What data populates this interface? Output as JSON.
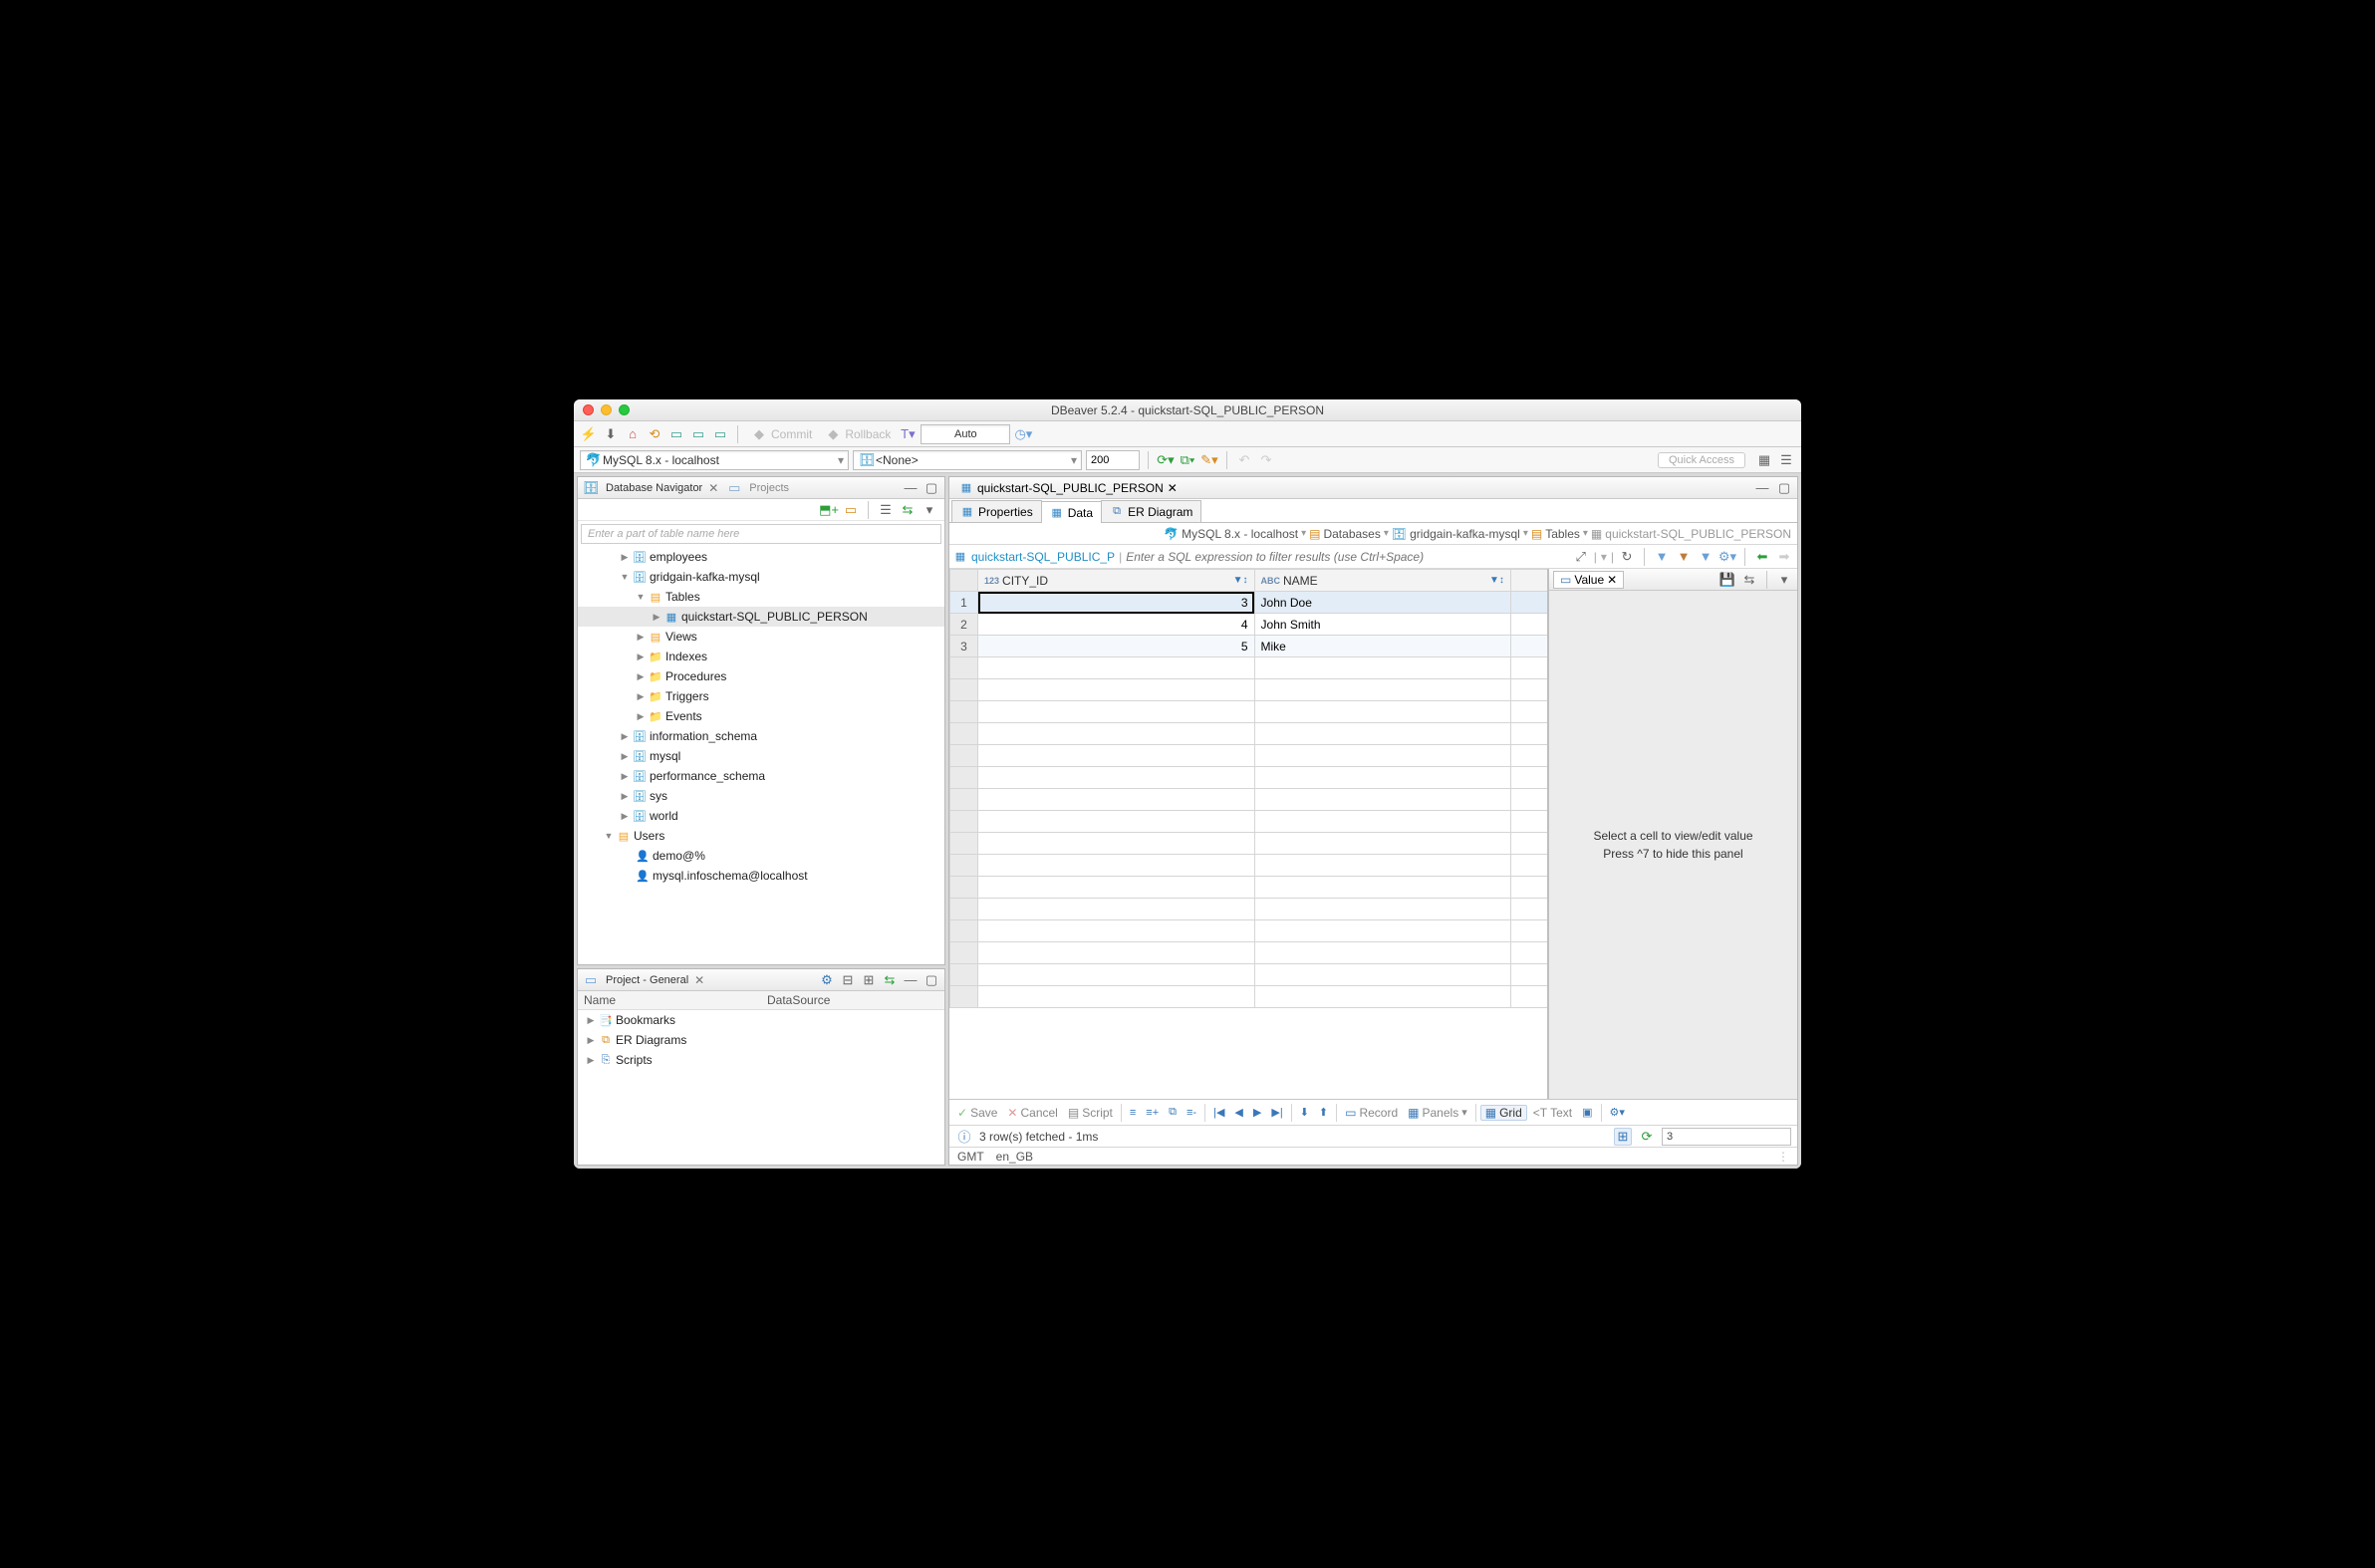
{
  "window": {
    "title": "DBeaver 5.2.4 - quickstart-SQL_PUBLIC_PERSON"
  },
  "toolbar1": {
    "commit": "Commit",
    "rollback": "Rollback",
    "mode": "Auto"
  },
  "toolbar2": {
    "connection": "MySQL 8.x - localhost",
    "database": "<None>",
    "rows": "200",
    "quick_access": "Quick Access"
  },
  "navigator": {
    "title": "Database Navigator",
    "projects_tab": "Projects",
    "search_placeholder": "Enter a part of table name here",
    "tree": {
      "employees": "employees",
      "gridgain": "gridgain-kafka-mysql",
      "tables": "Tables",
      "selected_table": "quickstart-SQL_PUBLIC_PERSON",
      "views": "Views",
      "indexes": "Indexes",
      "procedures": "Procedures",
      "triggers": "Triggers",
      "events": "Events",
      "info_schema": "information_schema",
      "mysql": "mysql",
      "perf_schema": "performance_schema",
      "sys": "sys",
      "world": "world",
      "users": "Users",
      "user1": "demo@%",
      "user2": "mysql.infoschema@localhost"
    }
  },
  "project_panel": {
    "title": "Project - General",
    "col_name": "Name",
    "col_ds": "DataSource",
    "items": {
      "bookmarks": "Bookmarks",
      "er": "ER Diagrams",
      "scripts": "Scripts"
    }
  },
  "editor": {
    "tab_title": "quickstart-SQL_PUBLIC_PERSON",
    "subtabs": {
      "properties": "Properties",
      "data": "Data",
      "er": "ER Diagram"
    },
    "breadcrumb": {
      "conn": "MySQL 8.x - localhost",
      "dbs": "Databases",
      "db": "gridgain-kafka-mysql",
      "tables": "Tables",
      "table": "quickstart-SQL_PUBLIC_PERSON"
    },
    "filter": {
      "title": "quickstart-SQL_PUBLIC_P",
      "placeholder": "Enter a SQL expression to filter results (use Ctrl+Space)"
    },
    "columns": {
      "c1": "CITY_ID",
      "c2": "NAME",
      "t1": "123",
      "t2": "ABC"
    },
    "rows": [
      {
        "n": "1",
        "city_id": "3",
        "name": "John Doe"
      },
      {
        "n": "2",
        "city_id": "4",
        "name": "John Smith"
      },
      {
        "n": "3",
        "city_id": "5",
        "name": "Mike"
      }
    ],
    "value_panel": {
      "title": "Value",
      "msg1": "Select a cell to view/edit value",
      "msg2": "Press ^7 to hide this panel"
    },
    "bottombar": {
      "save": "Save",
      "cancel": "Cancel",
      "script": "Script",
      "record": "Record",
      "panels": "Panels",
      "grid": "Grid",
      "text": "Text"
    },
    "status": {
      "msg": "3 row(s) fetched - 1ms",
      "refresh": "3"
    }
  },
  "appstatus": {
    "tz": "GMT",
    "locale": "en_GB"
  }
}
